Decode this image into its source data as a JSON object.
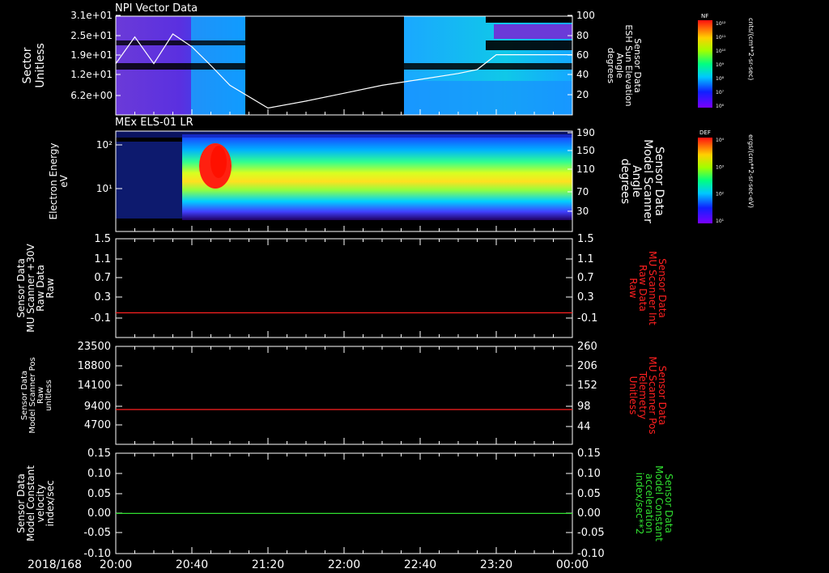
{
  "time_axis": {
    "date_label": "2018/168",
    "ticks": [
      "20:00",
      "20:40",
      "21:20",
      "22:00",
      "22:40",
      "23:20",
      "00:00"
    ]
  },
  "colors": {
    "axis": "#ffffff",
    "red_line": "#ff2020",
    "green_line": "#30e030",
    "red_label": "#ff2020",
    "green_label": "#30e030"
  },
  "chart_data": [
    {
      "type": "heatmap",
      "title": "NPI Vector Data",
      "ylabel": [
        "Sector",
        "Unitless"
      ],
      "yticks": [
        "3.1e+01",
        "2.5e+01",
        "1.9e+01",
        "1.2e+01",
        "6.2e+00"
      ],
      "y2label": [
        "Sensor Data",
        "ESH Sun Elevation",
        "Angle",
        "degrees"
      ],
      "y2ticks": [
        "100",
        "80",
        "60",
        "40",
        "20"
      ],
      "y2lim": [
        0,
        100
      ],
      "data_gap": [
        "21:00",
        "22:37"
      ],
      "overlay_line": {
        "name": "ESH Sun Elevation Angle",
        "x": [
          "20:00",
          "20:10",
          "20:20",
          "20:30",
          "20:40",
          "20:50",
          "21:00",
          "21:20",
          "21:40",
          "22:00",
          "22:20",
          "22:40",
          "23:00",
          "23:10",
          "23:20",
          "23:30",
          "00:00"
        ],
        "y": [
          52,
          79,
          52,
          82,
          69,
          50,
          30,
          7,
          14,
          22,
          30,
          36,
          42,
          46,
          61,
          61,
          61
        ]
      },
      "colorbar": {
        "label": "NF",
        "units": "cnts/(cm**2-sr-sec)",
        "ticks": [
          "10¹²",
          "10¹¹",
          "10¹⁰",
          "10⁹",
          "10⁸",
          "10⁷",
          "10⁶"
        ]
      }
    },
    {
      "type": "heatmap",
      "title": "MEx ELS-01 LR",
      "ylabel": [
        "Electron Energy",
        "eV"
      ],
      "yticks": [
        "10²",
        "10¹"
      ],
      "y2label": [
        "Sensor Data",
        "Model Scanner",
        "Angle",
        "degrees"
      ],
      "y2ticks": [
        "190",
        "150",
        "110",
        "70",
        "30"
      ],
      "colorbar": {
        "label": "DEF",
        "units": "ergs/(cm**2-sr-sec-eV)",
        "ticks": [
          "10⁴",
          "10³",
          "10²",
          "10¹"
        ]
      }
    },
    {
      "type": "line",
      "ylabel": [
        "Sensor Data",
        "MU Scanner +30V",
        "Raw Data",
        "Raw"
      ],
      "yticks": [
        "1.5",
        "1.1",
        "0.7",
        "0.3",
        "-0.1"
      ],
      "y2label": [
        "Sensor Data",
        "MU Scanner Int",
        "Raw Data",
        "Raw"
      ],
      "y2ticks": [
        "1.5",
        "1.1",
        "0.7",
        "0.3",
        "-0.1"
      ],
      "ylim": [
        -0.5,
        1.5
      ],
      "series": [
        {
          "values": [
            0.0,
            0.0
          ]
        }
      ]
    },
    {
      "type": "line",
      "ylabel": [
        "Sensor Data",
        "Model Scanner Pos",
        "Raw",
        "unitless"
      ],
      "yticks": [
        "23500",
        "18800",
        "14100",
        "9400",
        "4700"
      ],
      "y2label": [
        "Sensor Data",
        "MU Scanner Pos",
        "Telemetry",
        "Unitless"
      ],
      "y2ticks": [
        "260",
        "206",
        "152",
        "98",
        "44"
      ],
      "ylim": [
        0,
        23500
      ],
      "series": [
        {
          "values": [
            8350,
            8350
          ]
        }
      ]
    },
    {
      "type": "line",
      "ylabel": [
        "Sensor Data",
        "Model Constant",
        "velocity",
        "index/sec"
      ],
      "yticks": [
        "0.15",
        "0.10",
        "0.05",
        "0.00",
        "-0.05",
        "-0.10"
      ],
      "y2label": [
        "Sensor Data",
        "Model Constant",
        "acceleration",
        "index/sec**2"
      ],
      "y2ticks": [
        "0.15",
        "0.10",
        "0.05",
        "0.00",
        "-0.05",
        "-0.10"
      ],
      "ylim": [
        -0.1,
        0.15
      ],
      "series": [
        {
          "values": [
            0.0,
            0.0
          ]
        }
      ]
    }
  ]
}
